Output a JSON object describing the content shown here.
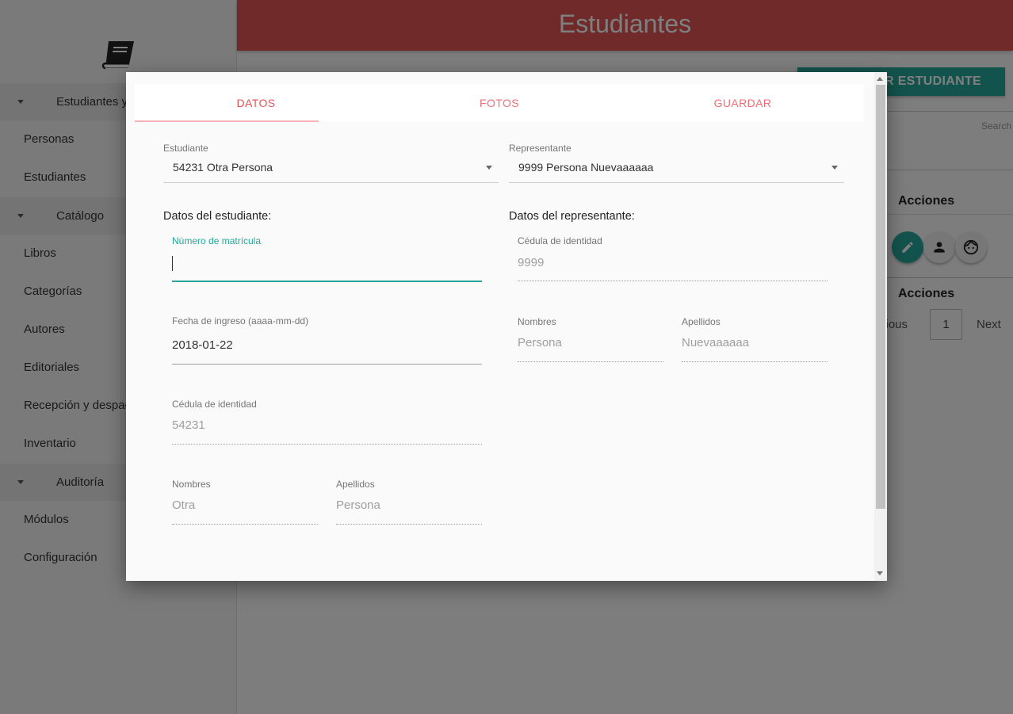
{
  "colors": {
    "brand": "#e05455",
    "accent": "#26a69a",
    "tab_text": "#ee6e73"
  },
  "sidebar": {
    "logo_icon": "book-icon",
    "groups": [
      {
        "label": "Estudiantes y",
        "items": [
          "Personas",
          "Estudiantes"
        ]
      },
      {
        "label": "Catálogo",
        "items": [
          "Libros",
          "Categorías",
          "Autores",
          "Editoriales",
          "Recepción y despach",
          "Inventario"
        ]
      },
      {
        "label": "Auditoría",
        "items": [
          "Módulos",
          "Configuración"
        ]
      }
    ]
  },
  "header": {
    "title": "Estudiantes"
  },
  "main": {
    "add_button": "AR ESTUDIANTE",
    "search_label": "Search",
    "table_header_actions": "Acciones",
    "table_footer_actions": "Acciones",
    "row_action_icons": [
      "pencil-icon",
      "person-icon",
      "face-icon"
    ],
    "pagination": {
      "previous": "vious",
      "current_page": "1",
      "next": "Next"
    }
  },
  "modal": {
    "tabs": [
      "DATOS",
      "FOTOS",
      "GUARDAR"
    ],
    "active_tab": "DATOS",
    "estudiante_select": {
      "label": "Estudiante",
      "value": "54231 Otra Persona"
    },
    "representante_select": {
      "label": "Representante",
      "value": "9999 Persona Nuevaaaaaa"
    },
    "student_section": {
      "title": "Datos del estudiante:",
      "matricula": {
        "label": "Número de matrícula",
        "value": ""
      },
      "fecha_ingreso": {
        "label": "Fecha de ingreso (aaaa-mm-dd)",
        "value": "2018-01-22"
      },
      "cedula": {
        "label": "Cédula de identidad",
        "value": "54231"
      },
      "nombres": {
        "label": "Nombres",
        "value": "Otra"
      },
      "apellidos": {
        "label": "Apellidos",
        "value": "Persona"
      }
    },
    "rep_section": {
      "title": "Datos del representante:",
      "cedula": {
        "label": "Cédula de identidad",
        "value": "9999"
      },
      "nombres": {
        "label": "Nombres",
        "value": "Persona"
      },
      "apellidos": {
        "label": "Apellidos",
        "value": "Nuevaaaaaa"
      }
    }
  }
}
